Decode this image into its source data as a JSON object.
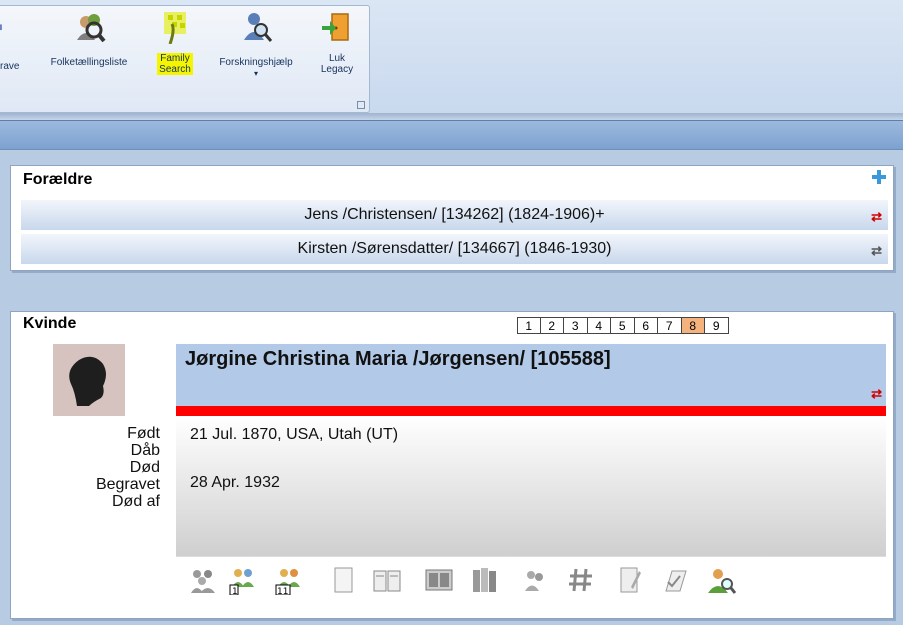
{
  "ribbon": {
    "buttons": [
      {
        "label": "rave"
      },
      {
        "label": "Folketællingsliste"
      },
      {
        "label": "Family",
        "label2": "Search"
      },
      {
        "label": "Forskningshjælp",
        "label2": "▾"
      },
      {
        "label": "Luk",
        "label2": "Legacy"
      }
    ],
    "highlight_color": "#f5f500"
  },
  "parents": {
    "title": "Forældre",
    "rows": [
      {
        "text": "Jens /Christensen/ [134262] (1824-1906)+",
        "swap_color": "#d00000"
      },
      {
        "text": "Kirsten /Sørensdatter/ [134667] (1846-1930)",
        "swap_color": "#555555"
      }
    ]
  },
  "person": {
    "sex_title": "Kvinde",
    "pages": [
      "1",
      "2",
      "3",
      "4",
      "5",
      "6",
      "7",
      "8",
      "9"
    ],
    "active_page": "8",
    "name": "Jørgine Christina Maria /Jørgensen/ [105588]",
    "labels": {
      "born": "Født",
      "christened": "Dåb",
      "died": "Død",
      "buried": "Begravet",
      "cause": "Død af"
    },
    "born": "21 Jul. 1870, USA, Utah (UT)",
    "died": "28 Apr. 1932",
    "icons": [
      "family-group-icon",
      "parents-1-icon",
      "parents-11-icon",
      "notes-icon",
      "sources-icon",
      "pictures-icon",
      "books-icon",
      "associations-icon",
      "hashtag-icon",
      "document-icon",
      "todo-icon",
      "research-icon"
    ]
  }
}
